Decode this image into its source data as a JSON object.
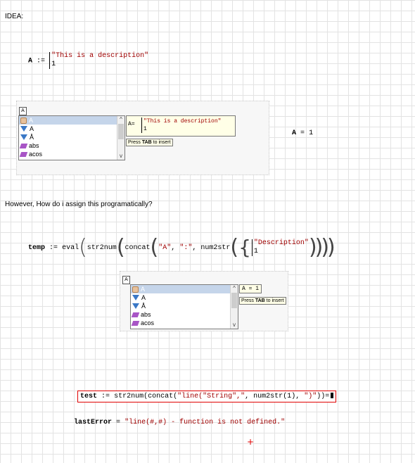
{
  "idea_label": "IDEA:",
  "def1": {
    "var": "A",
    "assign": ":=",
    "row1": "\"This is a description\"",
    "row2": "1"
  },
  "popup1": {
    "items": [
      "A",
      "A",
      "Å",
      "abs",
      "acos"
    ],
    "preview_var": "A",
    "preview_op": "=",
    "preview_row1": "\"This is a description\"",
    "preview_row2": "1",
    "hint_pre": "Press ",
    "hint_key": "TAB",
    "hint_post": " to insert"
  },
  "result1": {
    "var": "A",
    "op": "=",
    "val": "1"
  },
  "question": "However, How do i assign this programatically?",
  "temp": {
    "var": "temp",
    "assign": ":=",
    "eval": "eval",
    "str2num": "str2num",
    "concat": "concat",
    "arg1": "\"A\"",
    "comma1": ",",
    "arg2": "\":\"",
    "comma2": ",",
    "num2str": "num2str",
    "row1": "\"Description\"",
    "row2": "1"
  },
  "popup2": {
    "items": [
      "A",
      "A",
      "Å",
      "abs",
      "acos"
    ],
    "preview": "A = 1",
    "hint_pre": "Press ",
    "hint_key": "TAB",
    "hint_post": " to insert"
  },
  "test": {
    "var": "test",
    "assign": ":=",
    "f1": "str2num",
    "f2": "concat",
    "s1": "\"line(\"String\",\"",
    "comma1": ",",
    "f3": "num2str",
    "one": "1",
    "comma2": ",",
    "s2": "\")\"",
    "eq": "="
  },
  "error": {
    "label": "lastError",
    "eq": "=",
    "msg": "\"line(#,#) - function is not defined.\""
  },
  "cursor": "+"
}
